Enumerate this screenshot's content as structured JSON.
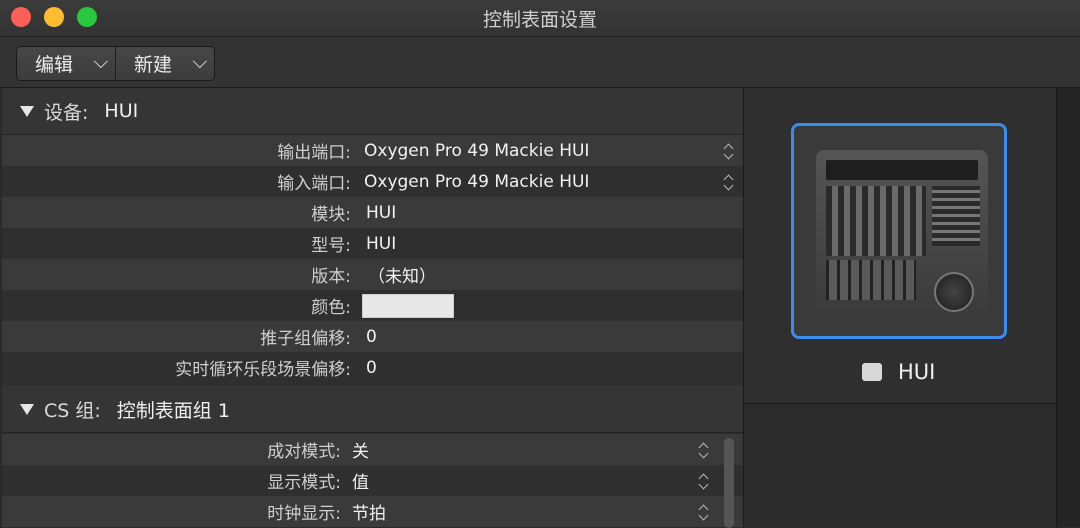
{
  "window": {
    "title": "控制表面设置"
  },
  "toolbar": {
    "edit_label": "编辑",
    "new_label": "新建"
  },
  "device_section": {
    "label": "设备:",
    "value": "HUI",
    "rows": [
      {
        "label": "输出端口:",
        "value": "Oxygen Pro 49 Mackie HUI"
      },
      {
        "label": "输入端口:",
        "value": "Oxygen Pro 49 Mackie HUI"
      },
      {
        "label": "模块:",
        "value": "HUI"
      },
      {
        "label": "型号:",
        "value": "HUI"
      },
      {
        "label": "版本:",
        "value": "（未知）"
      },
      {
        "label": "颜色:",
        "value": "",
        "color": "#e8e8e8"
      },
      {
        "label": "推子组偏移:",
        "value": "0"
      },
      {
        "label": "实时循环乐段场景偏移:",
        "value": "0"
      }
    ]
  },
  "cs_section": {
    "label": "CS 组:",
    "value": "控制表面组 1",
    "rows": [
      {
        "label": "成对模式:",
        "value": "关"
      },
      {
        "label": "显示模式:",
        "value": "值"
      },
      {
        "label": "时钟显示:",
        "value": "节拍"
      }
    ]
  },
  "device_preview": {
    "name": "HUI"
  },
  "colors": {
    "selection": "#3c8cf0"
  }
}
